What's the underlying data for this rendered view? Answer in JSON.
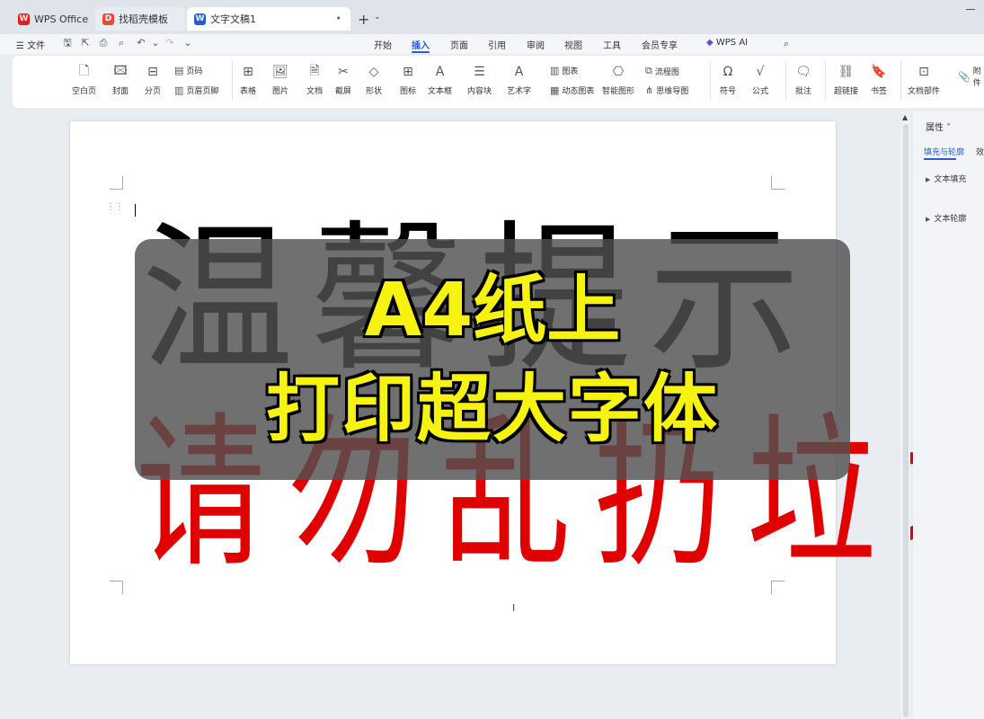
{
  "tabs": [
    {
      "label": "WPS Office",
      "icon": "wps-logo-icon",
      "color": "#e02020"
    },
    {
      "label": "找稻壳模板",
      "icon": "docer-icon",
      "color": "#e84a3a"
    },
    {
      "label": "文字文稿1",
      "icon": "word-doc-icon",
      "color": "#2a5bd7"
    }
  ],
  "menu": {
    "file": "☰ 文件",
    "tabs": [
      "开始",
      "插入",
      "页面",
      "引用",
      "审阅",
      "视图",
      "工具",
      "会员专享",
      "WPS AI"
    ],
    "active": "插入"
  },
  "ribbon": {
    "items": [
      {
        "label": "空白页",
        "icon": "blank-page-icon"
      },
      {
        "label": "封面",
        "icon": "cover-icon"
      },
      {
        "label": "分页",
        "icon": "page-break-icon"
      },
      {
        "label": "表格",
        "icon": "table-icon"
      },
      {
        "label": "图片",
        "icon": "picture-icon"
      },
      {
        "label": "文档",
        "icon": "document-icon"
      },
      {
        "label": "截屏",
        "icon": "screenshot-icon"
      },
      {
        "label": "形状",
        "icon": "shape-icon"
      },
      {
        "label": "图标",
        "icon": "icons-icon"
      },
      {
        "label": "文本框",
        "icon": "textbox-icon"
      },
      {
        "label": "内容块",
        "icon": "content-block-icon"
      },
      {
        "label": "艺术字",
        "icon": "wordart-icon"
      },
      {
        "label": "智能图形",
        "icon": "smartart-icon"
      },
      {
        "label": "符号",
        "icon": "symbol-icon"
      },
      {
        "label": "公式",
        "icon": "formula-icon"
      },
      {
        "label": "批注",
        "icon": "comment-icon"
      },
      {
        "label": "超链接",
        "icon": "hyperlink-icon"
      },
      {
        "label": "书签",
        "icon": "bookmark-icon"
      },
      {
        "label": "文档部件",
        "icon": "doc-parts-icon"
      }
    ],
    "small": {
      "page_number": "页码",
      "header_footer": "页眉页脚",
      "chart": "图表",
      "dynamic_chart": "动态图表",
      "flowchart": "流程图",
      "mindmap": "思维导图",
      "attachment": "附件"
    }
  },
  "document": {
    "line1": [
      "温",
      "馨",
      "提",
      "示"
    ],
    "line2": [
      "请",
      "勿",
      "乱",
      "扔",
      "垃",
      "圾"
    ],
    "overlay_line1": "A4纸上",
    "overlay_line2": "打印超大字体",
    "colors": {
      "line1": "#000000",
      "line2": "#e00000",
      "overlay_text": "#f7f310"
    }
  },
  "panel": {
    "title": "属性 ˅",
    "tab_active": "填充与轮廓",
    "tab_second": "效",
    "sections": [
      "文本填充",
      "文本轮廓"
    ]
  }
}
